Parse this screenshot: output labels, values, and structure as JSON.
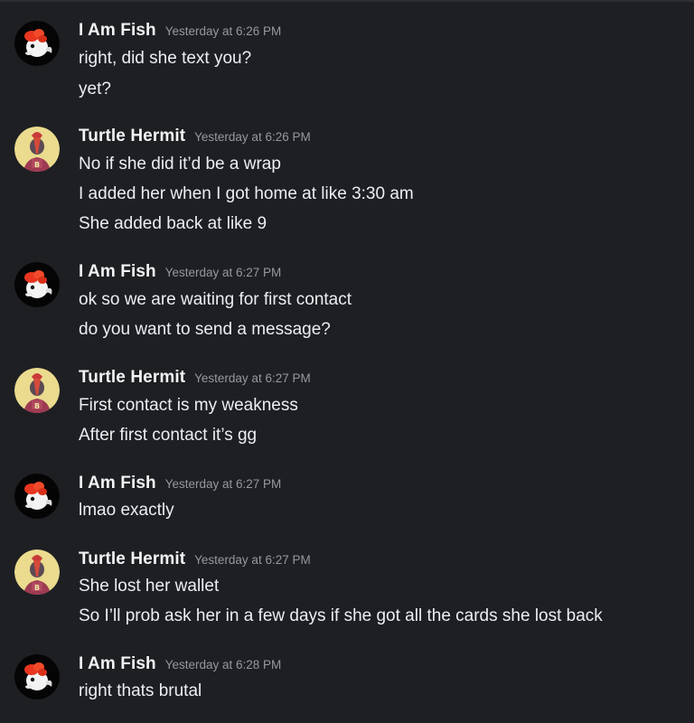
{
  "users": {
    "fish": {
      "name": "I Am Fish",
      "avatar_icon": "goldfish-avatar-icon"
    },
    "hermit": {
      "name": "Turtle Hermit",
      "avatar_icon": "turtle-hermit-avatar-icon"
    }
  },
  "colors": {
    "background": "#1e1f23",
    "username": "#f2f3f5",
    "timestamp": "#96989d",
    "message_text": "#eceef1"
  },
  "messages": [
    {
      "author": "I Am Fish",
      "timestamp": "Yesterday at 6:26 PM",
      "lines": [
        "right, did she text you?",
        "yet?"
      ]
    },
    {
      "author": "Turtle Hermit",
      "timestamp": "Yesterday at 6:26 PM",
      "lines": [
        "No if she did it’d be a wrap",
        "I added her when I got home at like 3:30 am",
        "She added back at like 9"
      ]
    },
    {
      "author": "I Am Fish",
      "timestamp": "Yesterday at 6:27 PM",
      "lines": [
        "ok so we are waiting for first contact",
        "do you want to send a message?"
      ]
    },
    {
      "author": "Turtle Hermit",
      "timestamp": "Yesterday at 6:27 PM",
      "lines": [
        "First contact is my weakness",
        "After first contact it’s gg"
      ]
    },
    {
      "author": "I Am Fish",
      "timestamp": "Yesterday at 6:27 PM",
      "lines": [
        "lmao exactly"
      ]
    },
    {
      "author": "Turtle Hermit",
      "timestamp": "Yesterday at 6:27 PM",
      "lines": [
        "She lost her wallet",
        "So I’ll prob ask her in a few days if she got all the cards she lost back"
      ]
    },
    {
      "author": "I Am Fish",
      "timestamp": "Yesterday at 6:28 PM",
      "lines": [
        "right thats brutal"
      ]
    }
  ]
}
